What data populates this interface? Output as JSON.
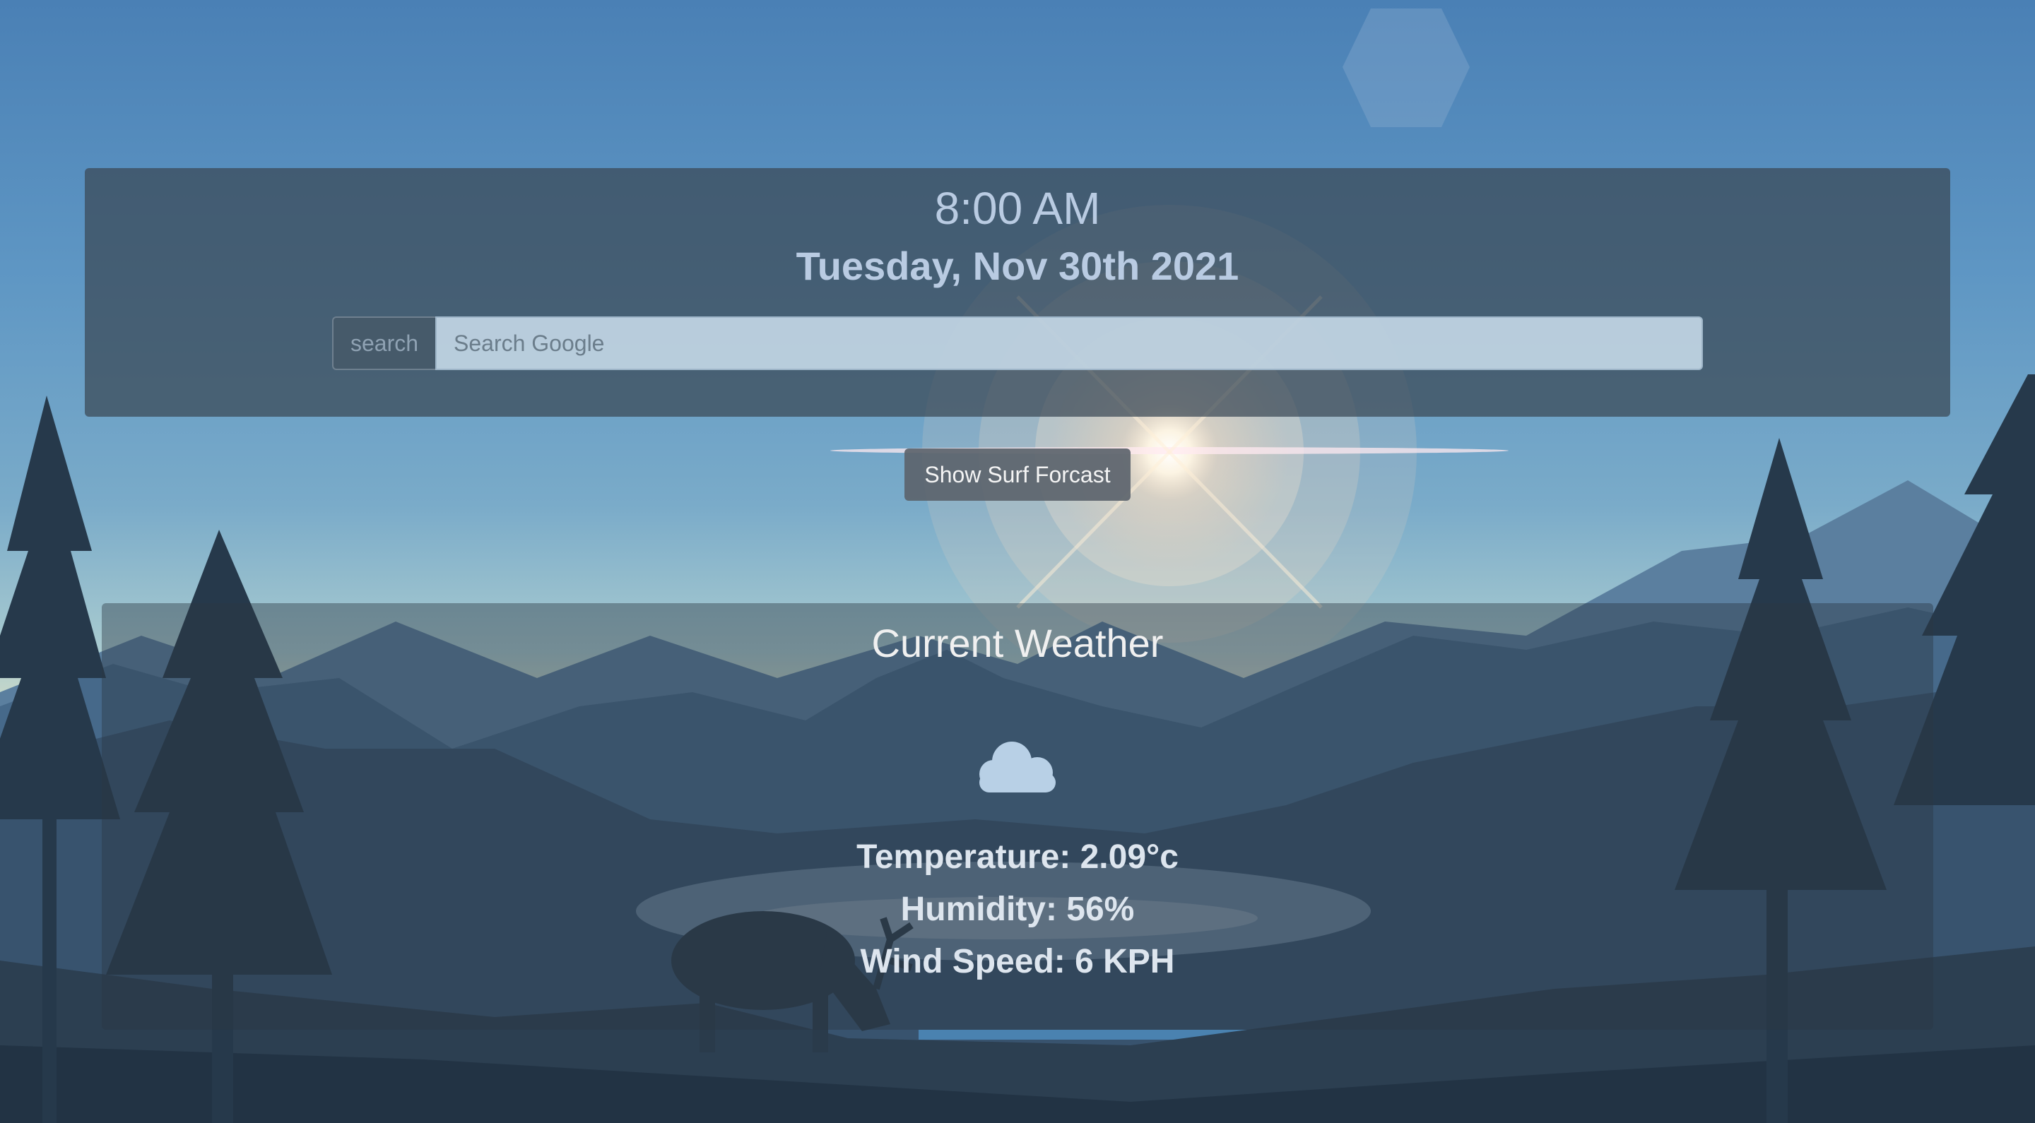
{
  "header": {
    "time": "8:00 AM",
    "date": "Tuesday, Nov 30th 2021"
  },
  "search": {
    "prefix_label": "search",
    "placeholder": "Search Google",
    "value": ""
  },
  "surf_button": {
    "label": "Show Surf Forcast"
  },
  "weather": {
    "title": "Current Weather",
    "icon": "cloud-icon",
    "temperature": "Temperature: 2.09°c",
    "humidity": "Humidity: 56%",
    "wind_speed": "Wind Speed: 6 KPH"
  },
  "colors": {
    "sky_top": "#4a80b5",
    "panel": "#3a4854",
    "text_light": "#b9cbe2",
    "button": "#5c646c"
  }
}
